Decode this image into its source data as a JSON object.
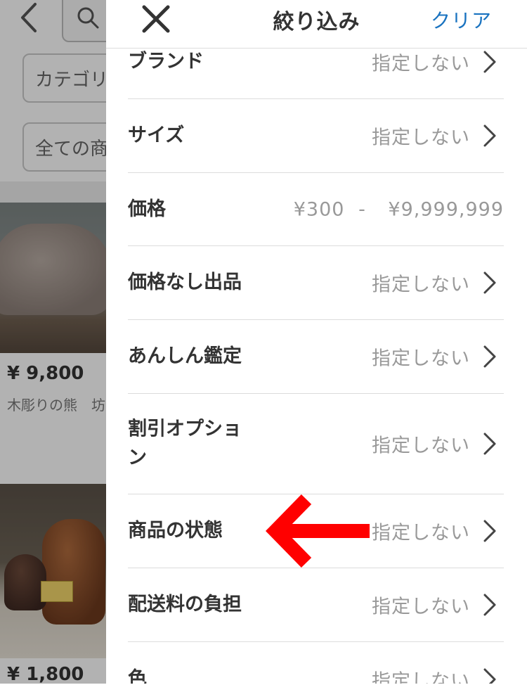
{
  "background": {
    "category_label": "カテゴリ",
    "all_items_label": "全ての商",
    "product1": {
      "price": "¥ 9,800",
      "name": "木彫りの熊　坊"
    },
    "product2": {
      "price": "¥ 1,800"
    },
    "icons": [
      "back-icon",
      "search-icon"
    ]
  },
  "panel": {
    "title": "絞り込み",
    "clear_label": "クリア",
    "rows": [
      {
        "label": "ブランド",
        "value": "指定しない"
      },
      {
        "label": "サイズ",
        "value": "指定しない"
      },
      {
        "label": "価格",
        "value_min": "¥300",
        "separator": "-",
        "value_max": "¥9,999,999"
      },
      {
        "label": "価格なし出品",
        "value": "指定しない"
      },
      {
        "label": "あんしん鑑定",
        "value": "指定しない"
      },
      {
        "label": "割引オプション",
        "value": "指定しない"
      },
      {
        "label": "商品の状態",
        "value": "指定しない"
      },
      {
        "label": "配送料の負担",
        "value": "指定しない"
      },
      {
        "label": "色",
        "value": "指定しない"
      }
    ]
  },
  "colors": {
    "accent": "#1a73c0",
    "annotation_arrow": "#ff0000"
  }
}
